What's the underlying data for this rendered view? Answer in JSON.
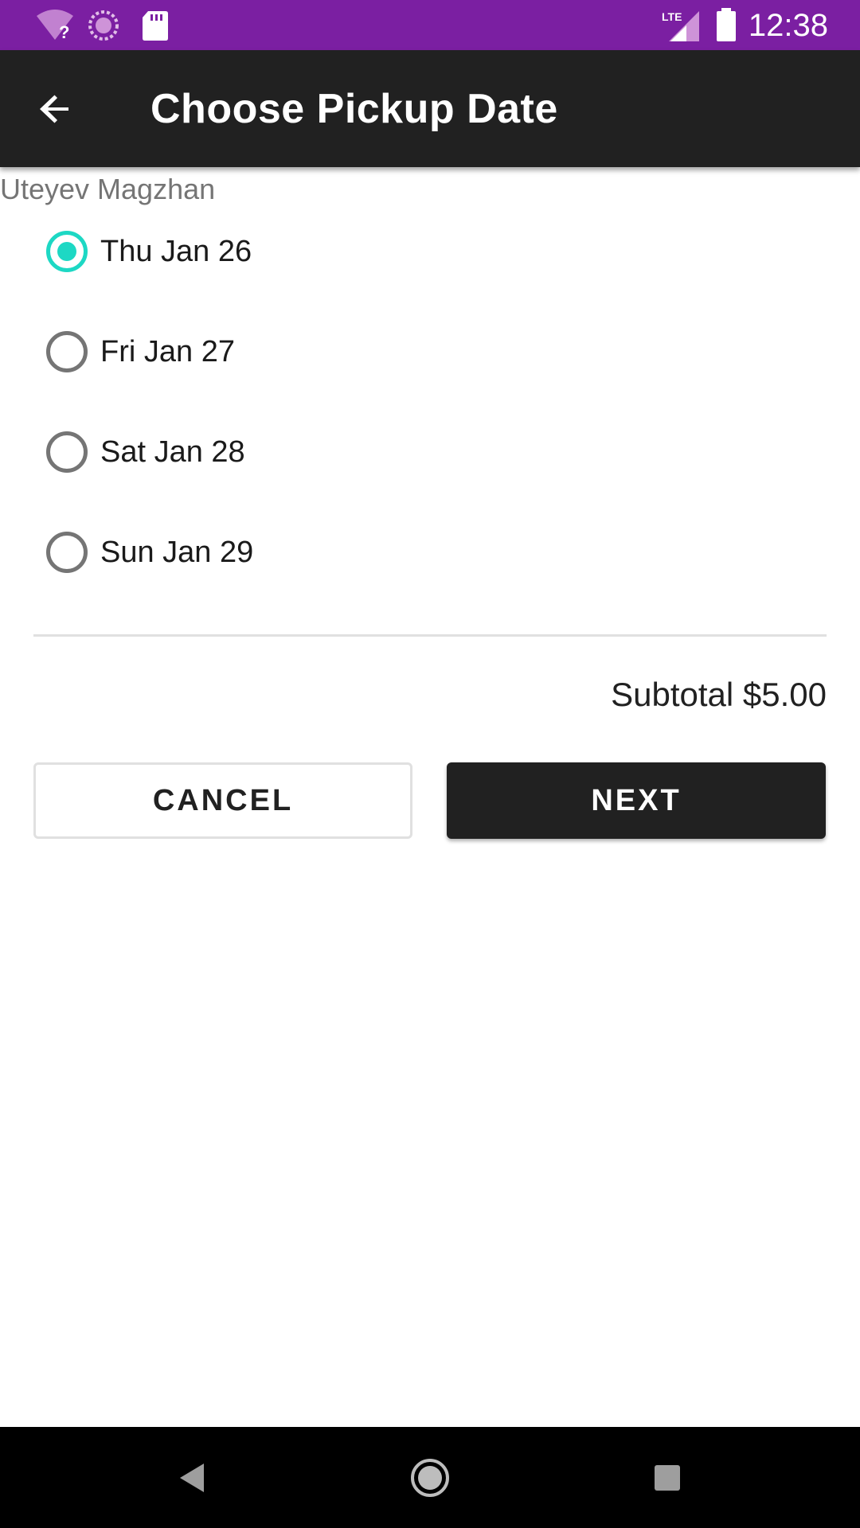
{
  "status_bar": {
    "time": "12:38",
    "network_label": "LTE",
    "icons": [
      "wifi-question-icon",
      "sync-icon",
      "sd-card-icon",
      "lte-signal-icon",
      "battery-icon"
    ]
  },
  "app_bar": {
    "title": "Choose Pickup Date",
    "back_icon": "arrow-back-icon"
  },
  "customer_name": "Uteyev Magzhan",
  "pickup_dates": [
    {
      "label": "Thu Jan 26",
      "selected": true
    },
    {
      "label": "Fri Jan 27",
      "selected": false
    },
    {
      "label": "Sat Jan 28",
      "selected": false
    },
    {
      "label": "Sun Jan 29",
      "selected": false
    }
  ],
  "subtotal": "Subtotal $5.00",
  "actions": {
    "cancel_label": "CANCEL",
    "next_label": "NEXT"
  },
  "nav_bar": {
    "icons": [
      "nav-back-icon",
      "nav-home-icon",
      "nav-recents-icon"
    ]
  },
  "colors": {
    "status_bar": "#7b1fa2",
    "app_bar": "#212121",
    "radio_accent": "#1dd8c4",
    "next_button": "#212121"
  }
}
